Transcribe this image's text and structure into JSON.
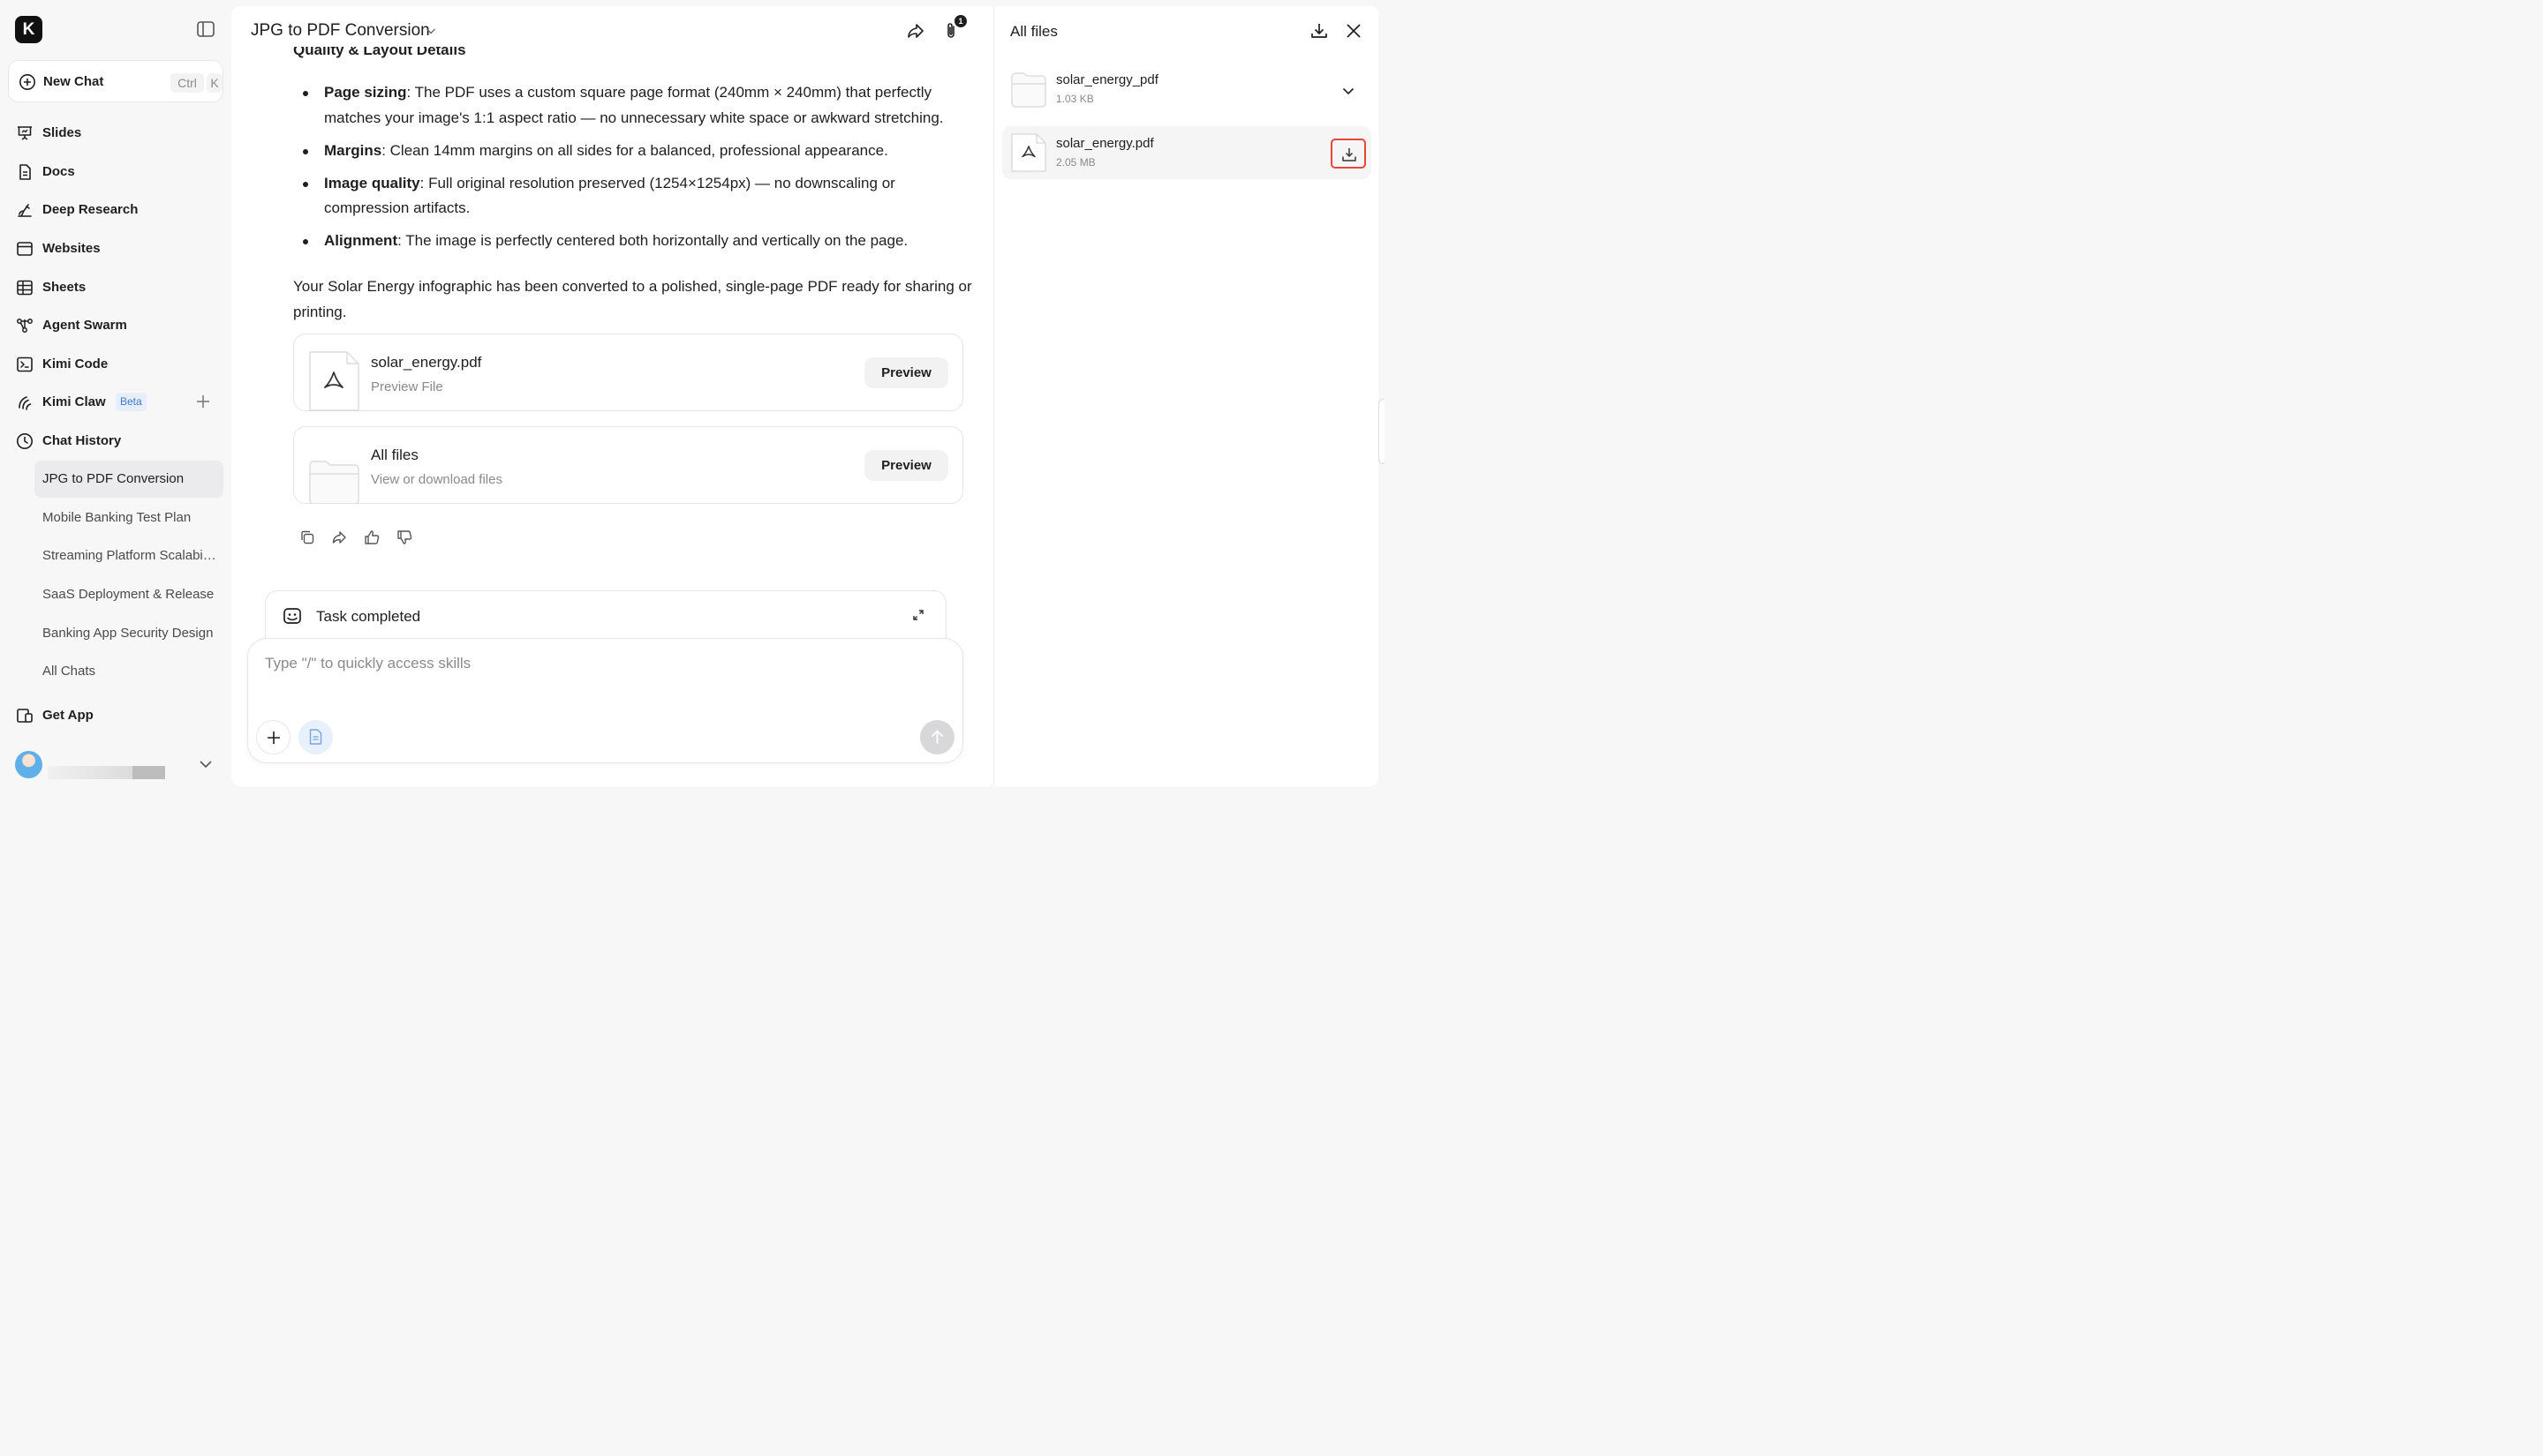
{
  "sidebar": {
    "logo_letter": "K",
    "new_chat": {
      "label": "New Chat",
      "shortcut_ctrl": "Ctrl",
      "shortcut_key": "K"
    },
    "nav": [
      {
        "label": "Slides",
        "icon": "slides-icon"
      },
      {
        "label": "Docs",
        "icon": "docs-icon"
      },
      {
        "label": "Deep Research",
        "icon": "deep-research-icon"
      },
      {
        "label": "Websites",
        "icon": "websites-icon"
      },
      {
        "label": "Sheets",
        "icon": "sheets-icon"
      },
      {
        "label": "Agent Swarm",
        "icon": "agent-swarm-icon"
      },
      {
        "label": "Kimi Code",
        "icon": "code-icon"
      },
      {
        "label": "Kimi Claw",
        "icon": "claw-icon",
        "badge": "Beta"
      },
      {
        "label": "Chat History",
        "icon": "clock-icon"
      }
    ],
    "history": [
      "JPG to PDF Conversion",
      "Mobile Banking Test Plan",
      "Streaming Platform Scalability",
      "SaaS Deployment & Release",
      "Banking App Security Design",
      "All Chats"
    ],
    "get_app": "Get App"
  },
  "header": {
    "title": "JPG to PDF Conversion",
    "attachment_count": "1"
  },
  "content": {
    "partial_heading": "Quality & Layout Details",
    "bullets": [
      {
        "term": "Page sizing",
        "text": ": The PDF uses a custom square page format (240mm × 240mm) that perfectly matches your image's 1:1 aspect ratio — no unnecessary white space or awkward stretching."
      },
      {
        "term": "Margins",
        "text": ": Clean 14mm margins on all sides for a balanced, professional appearance."
      },
      {
        "term": "Image quality",
        "text": ": Full original resolution preserved (1254×1254px) — no downscaling or compression artifacts."
      },
      {
        "term": "Alignment",
        "text": ": The image is perfectly centered both horizontally and vertically on the page."
      }
    ],
    "summary": "Your Solar Energy infographic has been converted to a polished, single-page PDF ready for sharing or printing.",
    "cards": [
      {
        "name": "solar_energy.pdf",
        "sub": "Preview File",
        "button": "Preview"
      },
      {
        "name": "All files",
        "sub": "View or download files",
        "button": "Preview"
      }
    ]
  },
  "task": {
    "label": "Task completed"
  },
  "composer": {
    "placeholder": "Type \"/\" to quickly access skills"
  },
  "files_panel": {
    "title": "All files",
    "items": [
      {
        "name": "solar_energy_pdf",
        "size": "1.03 KB",
        "type": "folder"
      },
      {
        "name": "solar_energy.pdf",
        "size": "2.05 MB",
        "type": "pdf"
      }
    ]
  },
  "colors": {
    "accent_red": "#e8453c",
    "beta_blue": "#3a7bd5"
  }
}
